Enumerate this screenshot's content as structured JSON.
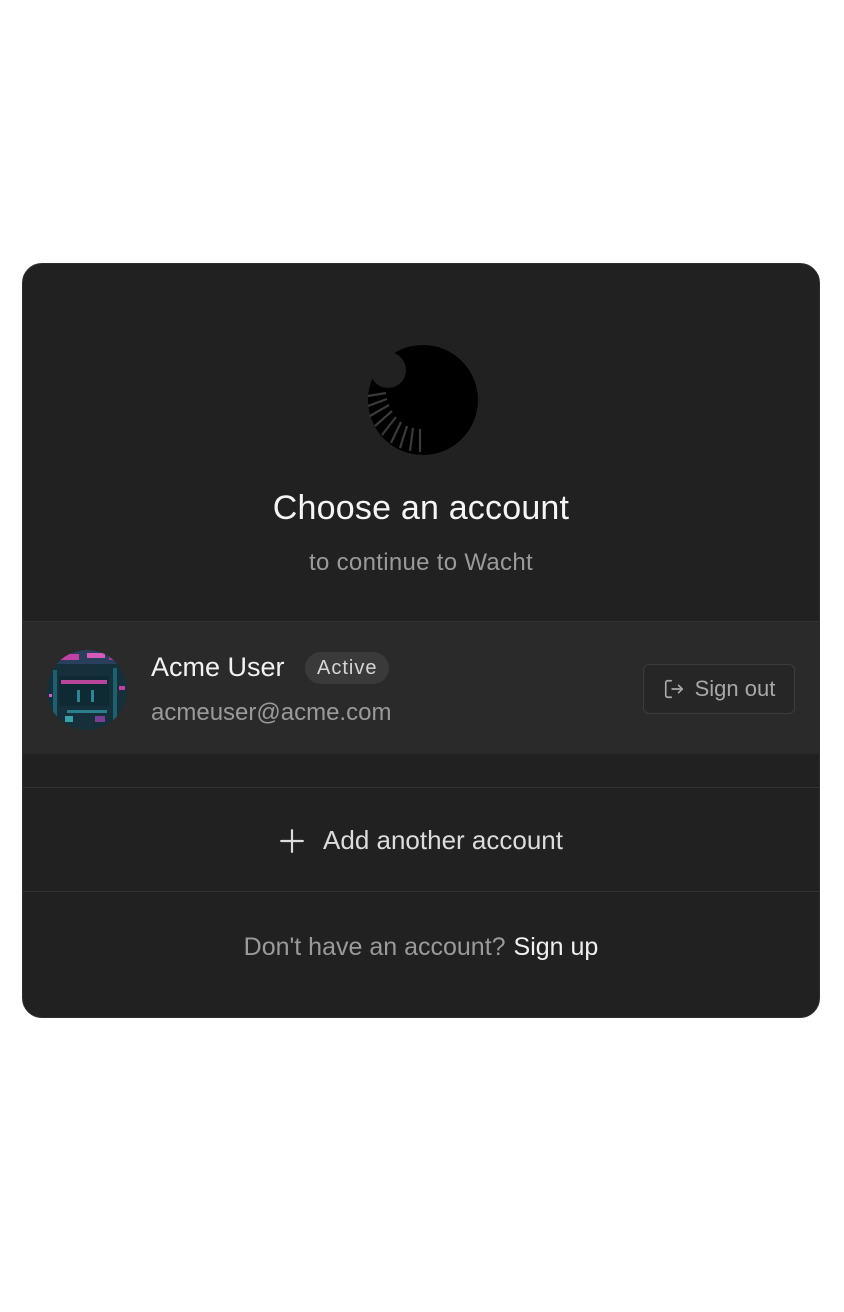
{
  "header": {
    "logo_icon": "wacht-logo-icon",
    "title": "Choose an account",
    "subtitle": "to continue to Wacht"
  },
  "account": {
    "name": "Acme User",
    "status_badge": "Active",
    "email": "acmeuser@acme.com",
    "avatar_icon": "circuit-board-avatar",
    "sign_out_label": "Sign out",
    "sign_out_icon": "sign-out-icon"
  },
  "add_account": {
    "label": "Add another account",
    "icon": "plus-icon"
  },
  "footer": {
    "prompt": "Don't have an account?",
    "link_label": "Sign up"
  },
  "colors": {
    "card_bg": "#212121",
    "row_bg": "#2a2a2a",
    "page_bg": "#ffffff"
  }
}
